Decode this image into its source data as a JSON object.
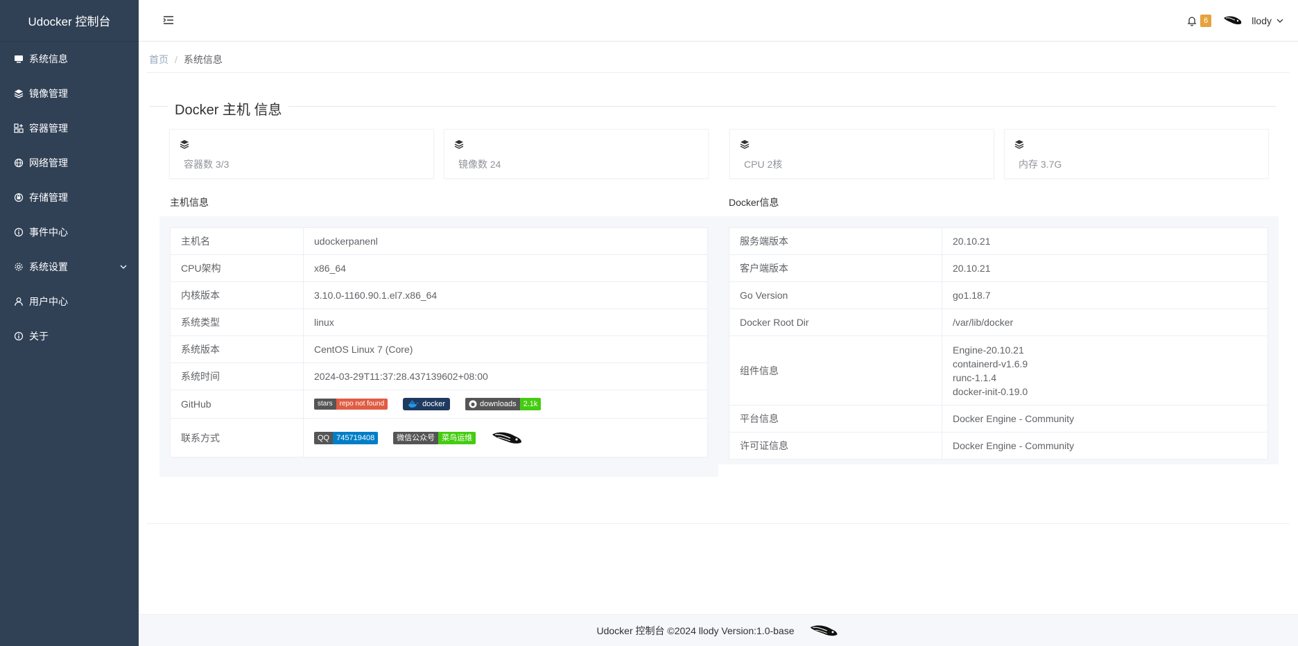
{
  "app": {
    "title": "Udocker 控制台"
  },
  "sidebar": {
    "items": [
      {
        "label": "系统信息",
        "icon": "monitor-icon"
      },
      {
        "label": "镜像管理",
        "icon": "layers-icon"
      },
      {
        "label": "容器管理",
        "icon": "grid-icon"
      },
      {
        "label": "网络管理",
        "icon": "globe-icon"
      },
      {
        "label": "存储管理",
        "icon": "storage-icon"
      },
      {
        "label": "事件中心",
        "icon": "info-icon"
      },
      {
        "label": "系统设置",
        "icon": "gear-icon"
      },
      {
        "label": "用户中心",
        "icon": "user-icon"
      },
      {
        "label": "关于",
        "icon": "info-icon"
      }
    ]
  },
  "header": {
    "notification_count": "6",
    "username": "llody"
  },
  "breadcrumb": {
    "home": "首页",
    "sep": "/",
    "current": "系统信息"
  },
  "section": {
    "title": "Docker 主机 信息"
  },
  "stats": [
    {
      "label": "容器数 3/3"
    },
    {
      "label": "镜像数 24"
    },
    {
      "label": "CPU 2核"
    },
    {
      "label": "内存 3.7G"
    }
  ],
  "host": {
    "title": "主机信息",
    "rows": [
      {
        "k": "主机名",
        "v": "udockerpanenl"
      },
      {
        "k": "CPU架构",
        "v": "x86_64"
      },
      {
        "k": "内核版本",
        "v": "3.10.0-1160.90.1.el7.x86_64"
      },
      {
        "k": "系统类型",
        "v": "linux"
      },
      {
        "k": "系统版本",
        "v": "CentOS Linux 7 (Core)"
      },
      {
        "k": "系统时间",
        "v": "2024-03-29T11:37:28.437139602+08:00"
      }
    ],
    "github_label": "GitHub",
    "contact_label": "联系方式",
    "badges": {
      "stars_l": "stars",
      "stars_r": "repo not found",
      "docker": "docker",
      "dl_l": "downloads",
      "dl_r": "2.1k",
      "qq_l": "QQ",
      "qq_r": "745719408",
      "wx_l": "微信公众号",
      "wx_r": "菜鸟运维"
    }
  },
  "docker": {
    "title": "Docker信息",
    "rows": [
      {
        "k": "服务端版本",
        "v": "20.10.21"
      },
      {
        "k": "客户端版本",
        "v": "20.10.21"
      },
      {
        "k": "Go Version",
        "v": "go1.18.7"
      },
      {
        "k": "Docker Root Dir",
        "v": "/var/lib/docker"
      }
    ],
    "components_label": "组件信息",
    "components": [
      "Engine-20.10.21",
      "containerd-v1.6.9",
      "runc-1.1.4",
      "docker-init-0.19.0"
    ],
    "rows2": [
      {
        "k": "平台信息",
        "v": "Docker Engine - Community"
      },
      {
        "k": "许可证信息",
        "v": "Docker Engine - Community"
      }
    ]
  },
  "footer": {
    "text": "Udocker 控制台 ©2024 llody Version:1.0-base"
  },
  "colors": {
    "sidebar_bg": "#304156",
    "badge_orange": "#e6a23c",
    "qq_blue": "#007ec6",
    "green": "#4c1"
  }
}
